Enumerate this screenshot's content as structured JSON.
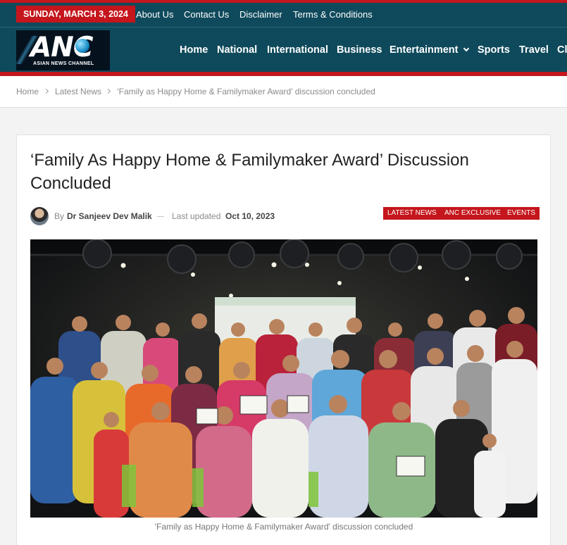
{
  "topbar": {
    "date": "SUNDAY, MARCH 3, 2024",
    "links": [
      "About Us",
      "Contact Us",
      "Disclaimer",
      "Terms & Conditions"
    ]
  },
  "logo": {
    "text": "ANC",
    "subtitle": "ASIAN NEWS CHANNEL"
  },
  "nav": {
    "items": [
      "Home",
      "National",
      "International",
      "Business",
      "Entertainment",
      "Sports",
      "Travel",
      "Cl"
    ]
  },
  "breadcrumb": {
    "home": "Home",
    "section": "Latest News",
    "current": "‘Family as Happy Home & Familymaker Award’ discussion concluded"
  },
  "article": {
    "title": "‘Family As Happy Home & Familymaker Award’ Discussion Concluded",
    "by_label": "By",
    "author": "Dr Sanjeev Dev Malik",
    "updated_label": "Last updated",
    "updated_date": "Oct 10, 2023",
    "tags": [
      "LATEST NEWS",
      "ANC EXCLUSIVE",
      "EVENTS"
    ],
    "caption": "'Family as Happy Home & Familymaker Award' discussion concluded"
  },
  "colors": {
    "brand_teal": "#0f4a5c",
    "accent_red": "#c4161c"
  }
}
